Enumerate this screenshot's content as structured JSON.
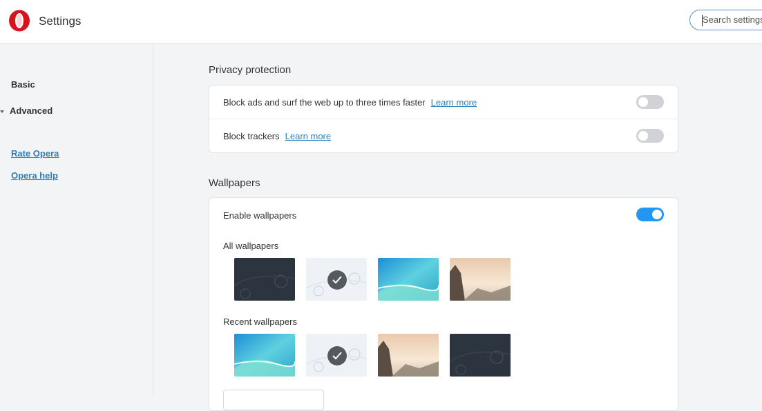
{
  "header": {
    "title": "Settings",
    "logo_icon": "opera-logo-icon",
    "search_placeholder": "Search settings"
  },
  "sidebar": {
    "basic_label": "Basic",
    "advanced_label": "Advanced",
    "links": [
      "Rate Opera",
      "Opera help"
    ]
  },
  "privacy": {
    "title": "Privacy protection",
    "rows": [
      {
        "text": "Block ads and surf the web up to three times faster",
        "link": "Learn more",
        "enabled": false
      },
      {
        "text": "Block trackers",
        "link": "Learn more",
        "enabled": false
      }
    ]
  },
  "wallpapers": {
    "title": "Wallpapers",
    "enable_label": "Enable wallpapers",
    "enabled": true,
    "all_label": "All wallpapers",
    "recent_label": "Recent wallpapers",
    "all": [
      "dark-bubbles",
      "light-bubbles",
      "aqua-wave",
      "mountain-sunrise"
    ],
    "recent": [
      "aqua-wave",
      "light-bubbles",
      "mountain-sunrise",
      "dark-bubbles"
    ],
    "selected": "light-bubbles"
  },
  "colors": {
    "accent": "#2196f3",
    "link": "#2f7fb8",
    "toggle_off": "#d0d2d6",
    "opera_red": "#e0202d"
  }
}
